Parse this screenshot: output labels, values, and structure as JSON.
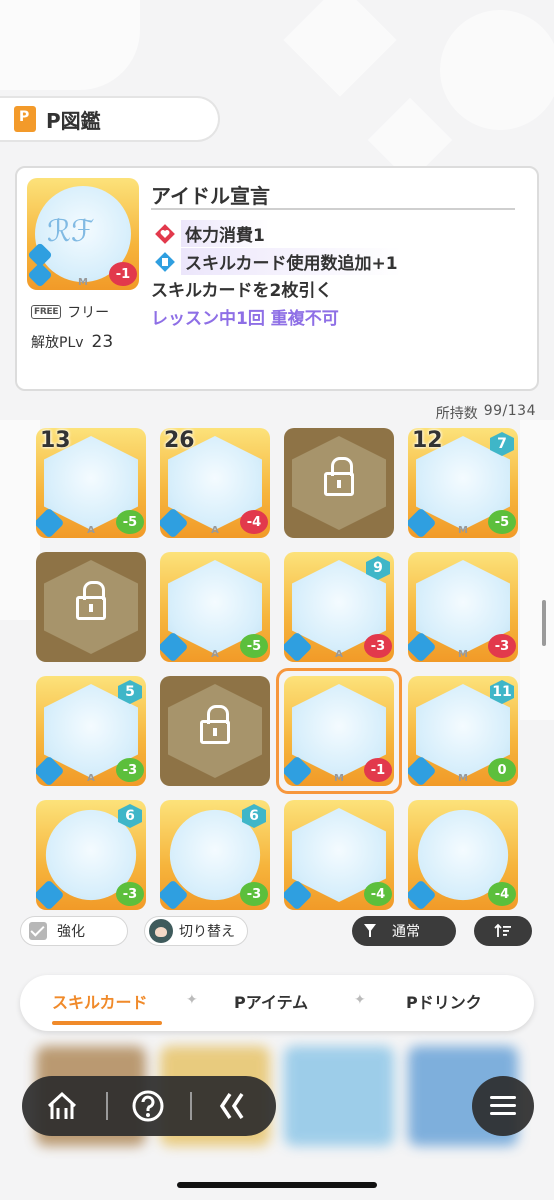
{
  "header": {
    "title": "P図鑑",
    "icon": "book-p-icon"
  },
  "detail": {
    "card_name": "アイドル宣言",
    "effects": [
      {
        "icon": "heart-diamond-icon",
        "text": "体力消費1"
      },
      {
        "icon": "skill-card-add-icon",
        "text": "スキルカード使用数追加+1"
      }
    ],
    "effect_text": "スキルカードを2枚引く",
    "effect_limit": "レッスン中1回 重複不可",
    "free_badge": "FREE",
    "free_label": "フリー",
    "plv_label": "解放PLv",
    "plv_value": "23",
    "card_cost": "-1",
    "card_rank": "M"
  },
  "owned": {
    "label": "所持数",
    "value": "99/134"
  },
  "cards": [
    {
      "count": "13",
      "cost": "-5",
      "cost_color": "green",
      "rank": "A",
      "locked": false
    },
    {
      "count": "26",
      "cost": "-4",
      "cost_color": "red",
      "rank": "A",
      "locked": false
    },
    {
      "count": "",
      "cost": "",
      "rank": "",
      "locked": true
    },
    {
      "count": "12",
      "pcount": "7",
      "cost": "-5",
      "cost_color": "green",
      "rank": "M",
      "locked": false
    },
    {
      "count": "",
      "cost": "",
      "rank": "",
      "locked": true
    },
    {
      "count": "",
      "cost": "-5",
      "cost_color": "green",
      "rank": "A",
      "locked": false
    },
    {
      "count": "",
      "pcount": "9",
      "cost": "-3",
      "cost_color": "red",
      "rank": "A",
      "locked": false
    },
    {
      "count": "",
      "cost": "-3",
      "cost_color": "red",
      "rank": "M",
      "locked": false
    },
    {
      "count": "",
      "pcount": "5",
      "cost": "-3",
      "cost_color": "green",
      "rank": "A",
      "locked": false
    },
    {
      "count": "",
      "cost": "",
      "rank": "",
      "locked": true
    },
    {
      "count": "",
      "cost": "-1",
      "cost_color": "red",
      "rank": "M",
      "locked": false,
      "selected": true
    },
    {
      "count": "",
      "pcount": "11",
      "cost": "0",
      "cost_color": "green",
      "rank": "M",
      "locked": false
    },
    {
      "count": "",
      "pcount": "6",
      "cost": "-3",
      "cost_color": "green",
      "rank": "",
      "locked": false,
      "round": true
    },
    {
      "count": "",
      "pcount": "6",
      "cost": "-3",
      "cost_color": "green",
      "rank": "",
      "locked": false,
      "round": true
    },
    {
      "count": "",
      "cost": "-4",
      "cost_color": "green",
      "rank": "",
      "locked": false
    },
    {
      "count": "",
      "cost": "-4",
      "cost_color": "green",
      "rank": "",
      "locked": false,
      "round": true
    }
  ],
  "filters": {
    "strength_label": "強化",
    "switch_label": "切り替え",
    "normal_label": "通常",
    "sort_icon": "sort-icon"
  },
  "tabs": [
    {
      "label": "スキルカード",
      "active": true
    },
    {
      "label": "Pアイテム",
      "active": false
    },
    {
      "label": "Pドリンク",
      "active": false
    }
  ],
  "nav": {
    "home_icon": "home-icon",
    "help_icon": "help-icon",
    "back_icon": "back-chevrons-icon",
    "menu_icon": "menu-icon"
  }
}
